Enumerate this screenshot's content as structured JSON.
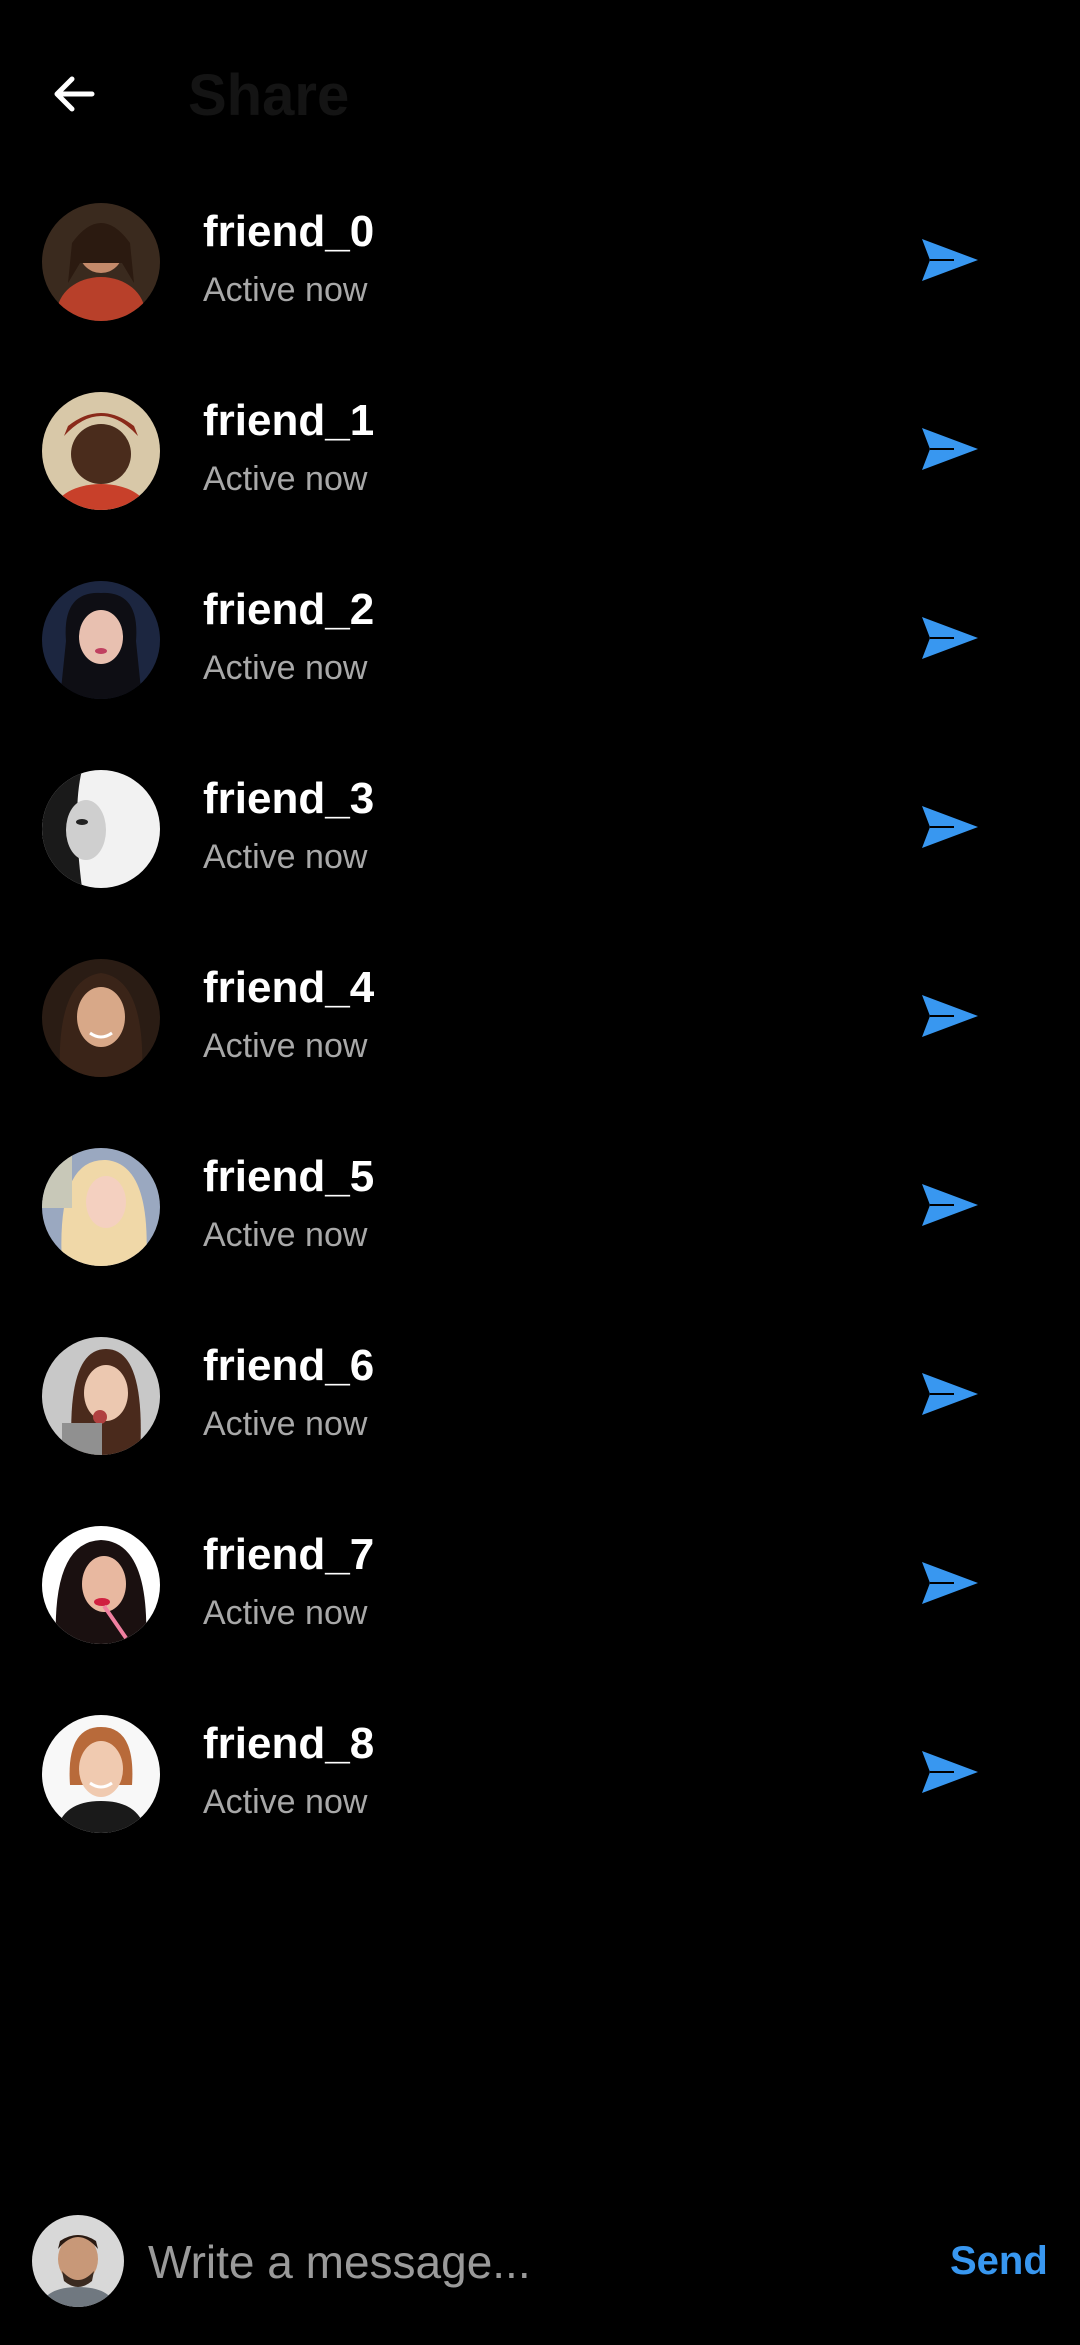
{
  "header": {
    "title": "Share",
    "back_icon": "arrow-left-icon"
  },
  "friends": [
    {
      "name": "friend_0",
      "status": "Active now"
    },
    {
      "name": "friend_1",
      "status": "Active now"
    },
    {
      "name": "friend_2",
      "status": "Active now"
    },
    {
      "name": "friend_3",
      "status": "Active now"
    },
    {
      "name": "friend_4",
      "status": "Active now"
    },
    {
      "name": "friend_5",
      "status": "Active now"
    },
    {
      "name": "friend_6",
      "status": "Active now"
    },
    {
      "name": "friend_7",
      "status": "Active now"
    },
    {
      "name": "friend_8",
      "status": "Active now"
    }
  ],
  "send_icon": "send-arrow-icon",
  "composer": {
    "placeholder": "Write a message...",
    "send_label": "Send"
  },
  "colors": {
    "background": "#000000",
    "accent": "#3897f0",
    "name_text": "#ffffff",
    "status_text": "#a8a8a8"
  }
}
